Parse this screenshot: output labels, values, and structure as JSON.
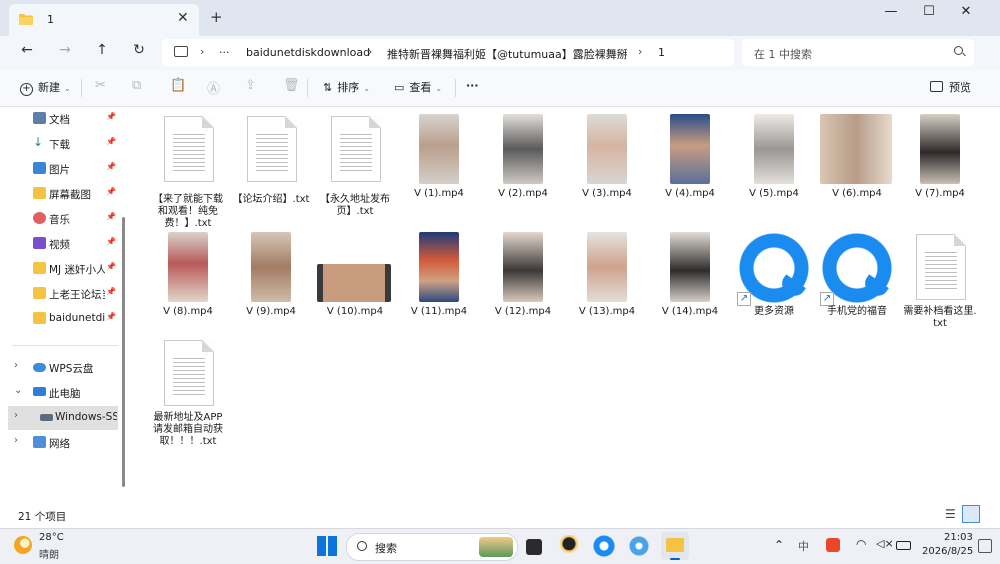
{
  "window": {
    "tab_title": "1",
    "minimize": "—",
    "maximize": "☐",
    "close": "✕",
    "new_tab": "+",
    "tab_close": "✕"
  },
  "address": {
    "ellipsis": "···",
    "segments": [
      "baidunetdiskdownload",
      "推特新晋裸舞福利姬【@tutumuaa】露脸裸舞掰B",
      "1"
    ]
  },
  "search": {
    "placeholder": "在 1 中搜索"
  },
  "toolbar": {
    "new_label": "新建",
    "sort_label": "排序",
    "view_label": "查看",
    "more_label": "···",
    "preview_label": "预览"
  },
  "sidebar": {
    "items": [
      {
        "label": "文档"
      },
      {
        "label": "下载"
      },
      {
        "label": "图片"
      },
      {
        "label": "屏幕截图"
      },
      {
        "label": "音乐"
      },
      {
        "label": "视频"
      },
      {
        "label": "MJ 迷奸小人到"
      },
      {
        "label": "上老王论坛当"
      },
      {
        "label": "baidunetdisk"
      }
    ],
    "tree": [
      {
        "label": "WPS云盘"
      },
      {
        "label": "此电脑"
      },
      {
        "label": "Windows-SSD"
      },
      {
        "label": "网络"
      }
    ]
  },
  "files": [
    {
      "name": "【来了就能下载和观看！纯免费！】.txt",
      "lines": [
        "【来了就能下载",
        "和观看！纯免",
        "费！】.txt"
      ]
    },
    {
      "name": "【论坛介绍】.txt",
      "lines": [
        "【论坛介绍】.txt"
      ]
    },
    {
      "name": "【永久地址发布页】.txt",
      "lines": [
        "【永久地址发布",
        "页】.txt"
      ]
    },
    {
      "name": "V (1).mp4"
    },
    {
      "name": "V (2).mp4"
    },
    {
      "name": "V (3).mp4"
    },
    {
      "name": "V (4).mp4"
    },
    {
      "name": "V (5).mp4"
    },
    {
      "name": "V (6).mp4"
    },
    {
      "name": "V (7).mp4"
    },
    {
      "name": "V (8).mp4"
    },
    {
      "name": "V (9).mp4"
    },
    {
      "name": "V (10).mp4"
    },
    {
      "name": "V (11).mp4"
    },
    {
      "name": "V (12).mp4"
    },
    {
      "name": "V (13).mp4"
    },
    {
      "name": "V (14).mp4"
    },
    {
      "name": "更多资源"
    },
    {
      "name": "手机党的福音"
    },
    {
      "name": "需要补档看这里.txt",
      "lines": [
        "需要补档看这里.",
        "txt"
      ]
    },
    {
      "name": "最新地址及APP请发邮箱自动获取！！！.txt",
      "lines": [
        "最新地址及APP",
        "请发邮箱自动获",
        "取！！！.txt"
      ]
    }
  ],
  "status": {
    "item_count": "21 个项目"
  },
  "taskbar": {
    "weather_temp": "28°C",
    "weather_desc": "晴朗",
    "search_placeholder": "搜索",
    "ime": "中",
    "time": "21:03",
    "date": "2026/8/25"
  },
  "colors": {
    "accent": "#0067c0",
    "tabbar": "#dfe6ef",
    "folder": "#f5c242",
    "qq_blue": "#1a8cf0"
  }
}
